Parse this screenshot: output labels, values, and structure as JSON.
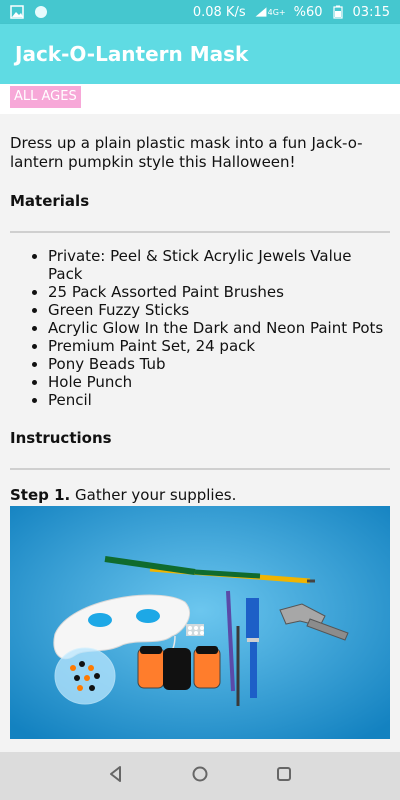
{
  "status_bar": {
    "network_speed": "0.08 K/s",
    "network_type": "4G+",
    "battery": "%60",
    "time": "03:15"
  },
  "app_bar": {
    "title": "Jack-O-Lantern Mask"
  },
  "badge": {
    "label": "ALL AGES"
  },
  "intro": "Dress up a plain plastic mask into a fun Jack-o-lantern pumpkin style this Halloween!",
  "materials": {
    "heading": "Materials",
    "items": [
      "Private: Peel & Stick Acrylic Jewels Value Pack",
      "25 Pack Assorted Paint Brushes",
      "Green Fuzzy Sticks",
      "Acrylic Glow In the Dark and Neon Paint Pots",
      "Premium Paint Set, 24 pack",
      "Pony Beads Tub",
      "Hole Punch",
      "Pencil"
    ]
  },
  "instructions": {
    "heading": "Instructions",
    "step1_label": "Step 1.",
    "step1_text": " Gather your supplies."
  },
  "colors": {
    "status_bar": "#45c7cf",
    "app_bar": "#5fdbe3",
    "badge": "#f7a8d8",
    "photo_bg": "#1da8e6"
  },
  "icons": {
    "status_left": [
      "image-icon",
      "circle-icon"
    ],
    "status_right": [
      "signal-icon",
      "battery-icon"
    ],
    "nav": [
      "back-icon",
      "home-icon",
      "recents-icon"
    ]
  }
}
